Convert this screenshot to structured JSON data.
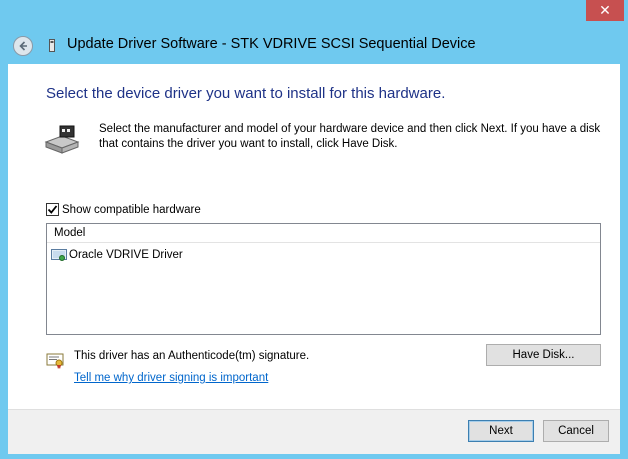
{
  "window": {
    "title": "Update Driver Software - STK VDRIVE SCSI Sequential Device",
    "close_glyph": "✕",
    "frame_color": "#6fc9ef",
    "close_color": "#c75050"
  },
  "main": {
    "instruction": "Select the device driver you want to install for this hardware.",
    "description": "Select the manufacturer and model of your hardware device and then click Next. If you have a disk that contains the driver you want to install, click Have Disk.",
    "show_compatible": {
      "label": "Show compatible hardware",
      "checked": true
    },
    "model_list": {
      "header": "Model",
      "items": [
        {
          "label": "Oracle VDRIVE Driver",
          "icon": "driver-icon"
        }
      ]
    },
    "signature_text": "This driver has an Authenticode(tm) signature.",
    "signing_link": "Tell me why driver signing is important",
    "have_disk_label": "Have Disk..."
  },
  "footer": {
    "next_label": "Next",
    "cancel_label": "Cancel"
  },
  "colors": {
    "instruction": "#1e3287",
    "link": "#0066cc"
  }
}
